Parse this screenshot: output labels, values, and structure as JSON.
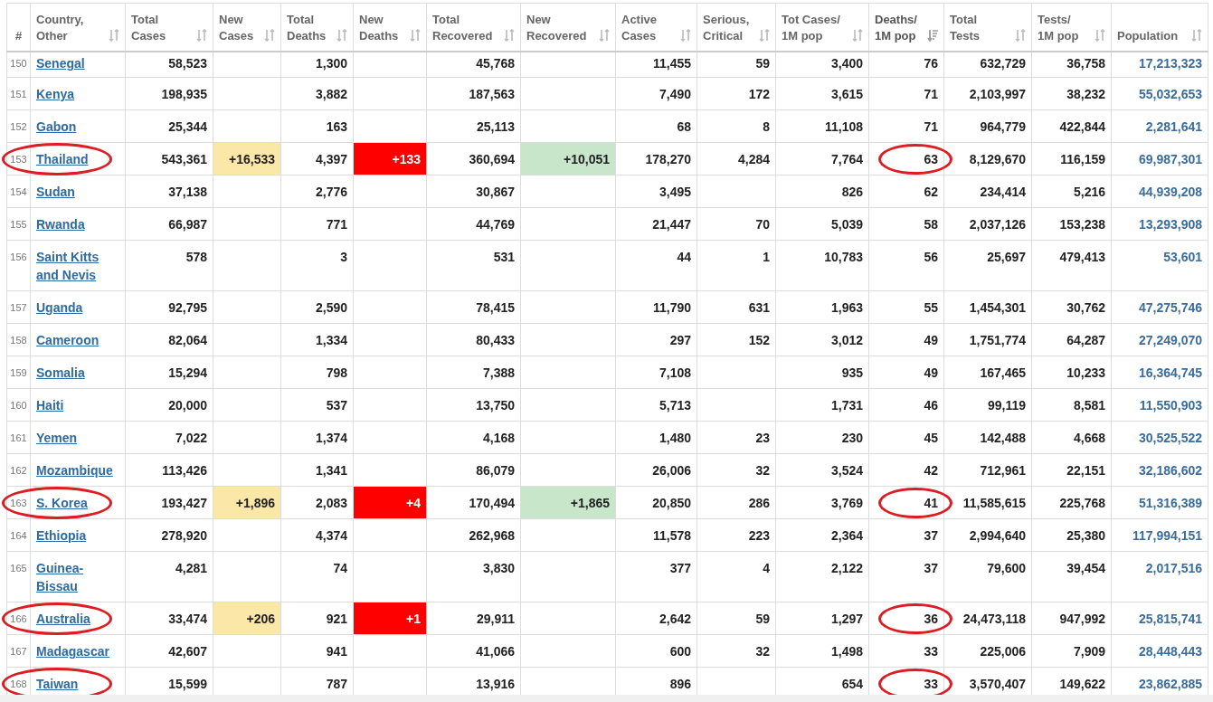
{
  "table": {
    "columns": [
      {
        "label": "#",
        "sortable": false,
        "sorted": false
      },
      {
        "label": "Country,\nOther",
        "sortable": true,
        "sorted": false
      },
      {
        "label": "Total\nCases",
        "sortable": true,
        "sorted": false
      },
      {
        "label": "New\nCases",
        "sortable": true,
        "sorted": false
      },
      {
        "label": "Total\nDeaths",
        "sortable": true,
        "sorted": false
      },
      {
        "label": "New\nDeaths",
        "sortable": true,
        "sorted": false
      },
      {
        "label": "Total\nRecovered",
        "sortable": true,
        "sorted": false
      },
      {
        "label": "New\nRecovered",
        "sortable": true,
        "sorted": false
      },
      {
        "label": "Active\nCases",
        "sortable": true,
        "sorted": false
      },
      {
        "label": "Serious,\nCritical",
        "sortable": true,
        "sorted": false
      },
      {
        "label": "Tot Cases/\n1M pop",
        "sortable": true,
        "sorted": false
      },
      {
        "label": "Deaths/\n1M pop",
        "sortable": true,
        "sorted": true
      },
      {
        "label": "Total\nTests",
        "sortable": true,
        "sorted": false
      },
      {
        "label": "Tests/\n1M pop",
        "sortable": true,
        "sorted": false
      },
      {
        "label": "Population",
        "sortable": true,
        "sorted": false
      }
    ],
    "rows": [
      {
        "rank": "150",
        "country": "Senegal",
        "total_cases": "58,523",
        "total_deaths": "1,300",
        "total_recovered": "45,768",
        "active_cases": "11,455",
        "serious_critical": "59",
        "tot_cases_per_1m": "3,400",
        "deaths_per_1m": "76",
        "total_tests": "632,729",
        "tests_per_1m": "36,758",
        "population": "17,213,323",
        "circled": false
      },
      {
        "rank": "151",
        "country": "Kenya",
        "total_cases": "198,935",
        "total_deaths": "3,882",
        "total_recovered": "187,563",
        "active_cases": "7,490",
        "serious_critical": "172",
        "tot_cases_per_1m": "3,615",
        "deaths_per_1m": "71",
        "total_tests": "2,103,997",
        "tests_per_1m": "38,232",
        "population": "55,032,653",
        "circled": false
      },
      {
        "rank": "152",
        "country": "Gabon",
        "total_cases": "25,344",
        "total_deaths": "163",
        "total_recovered": "25,113",
        "active_cases": "68",
        "serious_critical": "8",
        "tot_cases_per_1m": "11,108",
        "deaths_per_1m": "71",
        "total_tests": "964,779",
        "tests_per_1m": "422,844",
        "population": "2,281,641",
        "circled": false
      },
      {
        "rank": "153",
        "country": "Thailand",
        "total_cases": "543,361",
        "new_cases": "+16,533",
        "total_deaths": "4,397",
        "new_deaths": "+133",
        "total_recovered": "360,694",
        "new_recovered": "+10,051",
        "active_cases": "178,270",
        "serious_critical": "4,284",
        "tot_cases_per_1m": "7,764",
        "deaths_per_1m": "63",
        "total_tests": "8,129,670",
        "tests_per_1m": "116,159",
        "population": "69,987,301",
        "circled": true
      },
      {
        "rank": "154",
        "country": "Sudan",
        "total_cases": "37,138",
        "total_deaths": "2,776",
        "total_recovered": "30,867",
        "active_cases": "3,495",
        "tot_cases_per_1m": "826",
        "deaths_per_1m": "62",
        "total_tests": "234,414",
        "tests_per_1m": "5,216",
        "population": "44,939,208",
        "circled": false
      },
      {
        "rank": "155",
        "country": "Rwanda",
        "total_cases": "66,987",
        "total_deaths": "771",
        "total_recovered": "44,769",
        "active_cases": "21,447",
        "serious_critical": "70",
        "tot_cases_per_1m": "5,039",
        "deaths_per_1m": "58",
        "total_tests": "2,037,126",
        "tests_per_1m": "153,238",
        "population": "13,293,908",
        "circled": false
      },
      {
        "rank": "156",
        "country": "Saint Kitts and Nevis",
        "total_cases": "578",
        "total_deaths": "3",
        "total_recovered": "531",
        "active_cases": "44",
        "serious_critical": "1",
        "tot_cases_per_1m": "10,783",
        "deaths_per_1m": "56",
        "total_tests": "25,697",
        "tests_per_1m": "479,413",
        "population": "53,601",
        "circled": false
      },
      {
        "rank": "157",
        "country": "Uganda",
        "total_cases": "92,795",
        "total_deaths": "2,590",
        "total_recovered": "78,415",
        "active_cases": "11,790",
        "serious_critical": "631",
        "tot_cases_per_1m": "1,963",
        "deaths_per_1m": "55",
        "total_tests": "1,454,301",
        "tests_per_1m": "30,762",
        "population": "47,275,746",
        "circled": false
      },
      {
        "rank": "158",
        "country": "Cameroon",
        "total_cases": "82,064",
        "total_deaths": "1,334",
        "total_recovered": "80,433",
        "active_cases": "297",
        "serious_critical": "152",
        "tot_cases_per_1m": "3,012",
        "deaths_per_1m": "49",
        "total_tests": "1,751,774",
        "tests_per_1m": "64,287",
        "population": "27,249,070",
        "circled": false
      },
      {
        "rank": "159",
        "country": "Somalia",
        "total_cases": "15,294",
        "total_deaths": "798",
        "total_recovered": "7,388",
        "active_cases": "7,108",
        "tot_cases_per_1m": "935",
        "deaths_per_1m": "49",
        "total_tests": "167,465",
        "tests_per_1m": "10,233",
        "population": "16,364,745",
        "circled": false
      },
      {
        "rank": "160",
        "country": "Haiti",
        "total_cases": "20,000",
        "total_deaths": "537",
        "total_recovered": "13,750",
        "active_cases": "5,713",
        "tot_cases_per_1m": "1,731",
        "deaths_per_1m": "46",
        "total_tests": "99,119",
        "tests_per_1m": "8,581",
        "population": "11,550,903",
        "circled": false
      },
      {
        "rank": "161",
        "country": "Yemen",
        "total_cases": "7,022",
        "total_deaths": "1,374",
        "total_recovered": "4,168",
        "active_cases": "1,480",
        "serious_critical": "23",
        "tot_cases_per_1m": "230",
        "deaths_per_1m": "45",
        "total_tests": "142,488",
        "tests_per_1m": "4,668",
        "population": "30,525,522",
        "circled": false
      },
      {
        "rank": "162",
        "country": "Mozambique",
        "total_cases": "113,426",
        "total_deaths": "1,341",
        "total_recovered": "86,079",
        "active_cases": "26,006",
        "serious_critical": "32",
        "tot_cases_per_1m": "3,524",
        "deaths_per_1m": "42",
        "total_tests": "712,961",
        "tests_per_1m": "22,151",
        "population": "32,186,602",
        "circled": false
      },
      {
        "rank": "163",
        "country": "S. Korea",
        "total_cases": "193,427",
        "new_cases": "+1,896",
        "total_deaths": "2,083",
        "new_deaths": "+4",
        "total_recovered": "170,494",
        "new_recovered": "+1,865",
        "active_cases": "20,850",
        "serious_critical": "286",
        "tot_cases_per_1m": "3,769",
        "deaths_per_1m": "41",
        "total_tests": "11,585,615",
        "tests_per_1m": "225,768",
        "population": "51,316,389",
        "circled": true
      },
      {
        "rank": "164",
        "country": "Ethiopia",
        "total_cases": "278,920",
        "total_deaths": "4,374",
        "total_recovered": "262,968",
        "active_cases": "11,578",
        "serious_critical": "223",
        "tot_cases_per_1m": "2,364",
        "deaths_per_1m": "37",
        "total_tests": "2,994,640",
        "tests_per_1m": "25,380",
        "population": "117,994,151",
        "circled": false
      },
      {
        "rank": "165",
        "country": "Guinea-Bissau",
        "total_cases": "4,281",
        "total_deaths": "74",
        "total_recovered": "3,830",
        "active_cases": "377",
        "serious_critical": "4",
        "tot_cases_per_1m": "2,122",
        "deaths_per_1m": "37",
        "total_tests": "79,600",
        "tests_per_1m": "39,454",
        "population": "2,017,516",
        "circled": false
      },
      {
        "rank": "166",
        "country": "Australia",
        "total_cases": "33,474",
        "new_cases": "+206",
        "total_deaths": "921",
        "new_deaths": "+1",
        "total_recovered": "29,911",
        "active_cases": "2,642",
        "serious_critical": "59",
        "tot_cases_per_1m": "1,297",
        "deaths_per_1m": "36",
        "total_tests": "24,473,118",
        "tests_per_1m": "947,992",
        "population": "25,815,741",
        "circled": true
      },
      {
        "rank": "167",
        "country": "Madagascar",
        "total_cases": "42,607",
        "total_deaths": "941",
        "total_recovered": "41,066",
        "active_cases": "600",
        "serious_critical": "32",
        "tot_cases_per_1m": "1,498",
        "deaths_per_1m": "33",
        "total_tests": "225,006",
        "tests_per_1m": "7,909",
        "population": "28,448,443",
        "circled": false
      },
      {
        "rank": "168",
        "country": "Taiwan",
        "total_cases": "15,599",
        "total_deaths": "787",
        "total_recovered": "13,916",
        "active_cases": "896",
        "tot_cases_per_1m": "654",
        "deaths_per_1m": "33",
        "total_tests": "3,570,407",
        "tests_per_1m": "149,622",
        "population": "23,862,885",
        "circled": true
      }
    ]
  }
}
